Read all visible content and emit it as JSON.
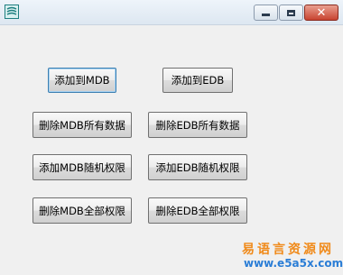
{
  "window": {
    "controls": {
      "minimize": "minimize-icon",
      "maximize": "maximize-icon",
      "close": "close-icon",
      "close_glyph": "✕"
    },
    "icon": "app-icon"
  },
  "buttons": {
    "add_to_mdb": "添加到MDB",
    "add_to_edb": "添加到EDB",
    "delete_all_mdb": "删除MDB所有数据",
    "delete_all_edb": "删除EDB所有数据",
    "add_random_mdb": "添加MDB随机权限",
    "add_random_edb": "添加EDB随机权限",
    "delete_all_mdb_perms": "删除MDB全部权限",
    "delete_all_edb_perms": "删除EDB全部权限"
  },
  "watermark": {
    "site_name": "易语言资源网",
    "url": "www.e5a5x.com"
  }
}
